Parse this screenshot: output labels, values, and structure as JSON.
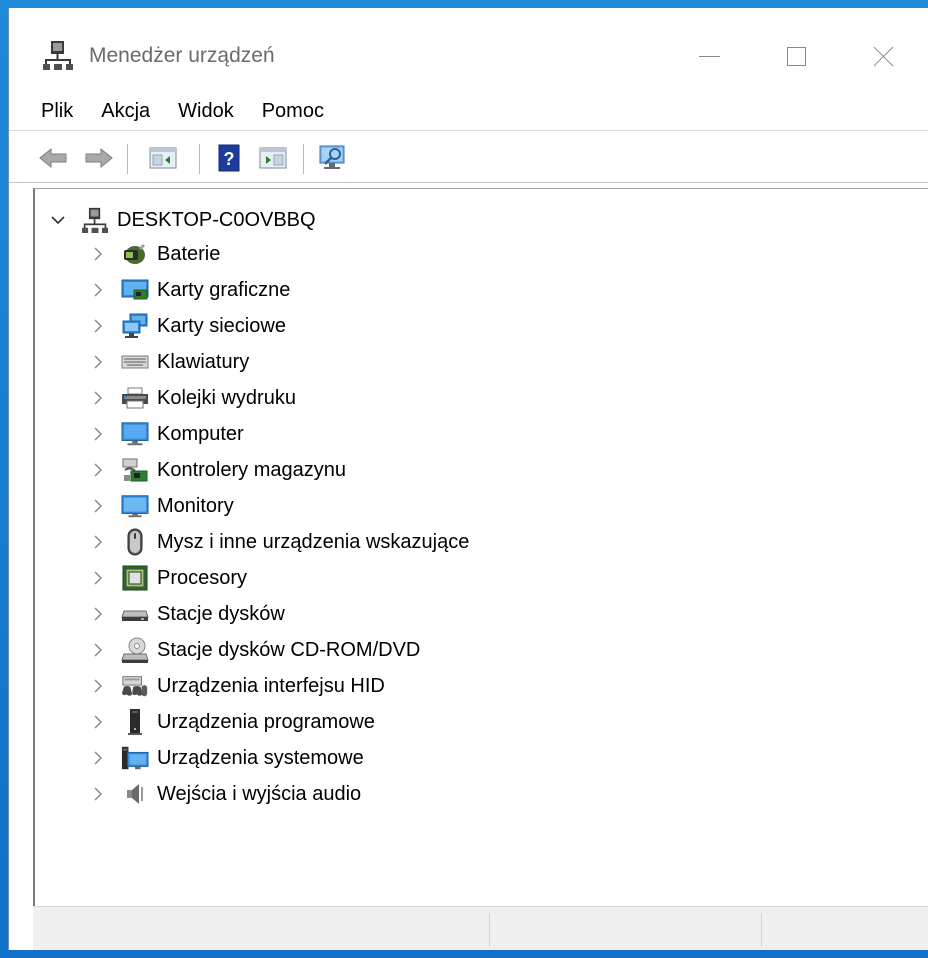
{
  "window": {
    "title": "Menedżer urządzeń",
    "controls": [
      "minimize",
      "maximize",
      "close"
    ]
  },
  "menu": {
    "items": [
      "Plik",
      "Akcja",
      "Widok",
      "Pomoc"
    ]
  },
  "toolbar": {
    "buttons": [
      {
        "name": "back-arrow-icon"
      },
      {
        "name": "forward-arrow-icon"
      },
      {
        "name": "show-hide-console-tree-icon"
      },
      {
        "name": "help-icon"
      },
      {
        "name": "show-action-pane-icon"
      },
      {
        "name": "scan-hardware-changes-icon"
      }
    ]
  },
  "tree": {
    "root": {
      "label": "DESKTOP-C0OVBBQ",
      "expanded": true
    },
    "items": [
      {
        "label": "Baterie",
        "icon": "battery-icon"
      },
      {
        "label": "Karty graficzne",
        "icon": "display-adapter-icon"
      },
      {
        "label": "Karty sieciowe",
        "icon": "network-adapter-icon"
      },
      {
        "label": "Klawiatury",
        "icon": "keyboard-icon"
      },
      {
        "label": "Kolejki wydruku",
        "icon": "printer-icon"
      },
      {
        "label": "Komputer",
        "icon": "computer-icon"
      },
      {
        "label": "Kontrolery magazynu",
        "icon": "storage-controller-icon"
      },
      {
        "label": "Monitory",
        "icon": "monitor-icon"
      },
      {
        "label": "Mysz i inne urządzenia wskazujące",
        "icon": "mouse-icon"
      },
      {
        "label": "Procesory",
        "icon": "processor-icon"
      },
      {
        "label": "Stacje dysków",
        "icon": "disk-drive-icon"
      },
      {
        "label": "Stacje dysków CD-ROM/DVD",
        "icon": "cd-rom-icon"
      },
      {
        "label": "Urządzenia interfejsu HID",
        "icon": "hid-icon"
      },
      {
        "label": "Urządzenia programowe",
        "icon": "software-device-icon"
      },
      {
        "label": "Urządzenia systemowe",
        "icon": "system-device-icon"
      },
      {
        "label": "Wejścia i wyjścia audio",
        "icon": "speaker-icon"
      }
    ]
  },
  "colors": {
    "accent": "#1a84d9",
    "title_text": "#6b6b6b",
    "statusbar": "#f0f0f0"
  }
}
